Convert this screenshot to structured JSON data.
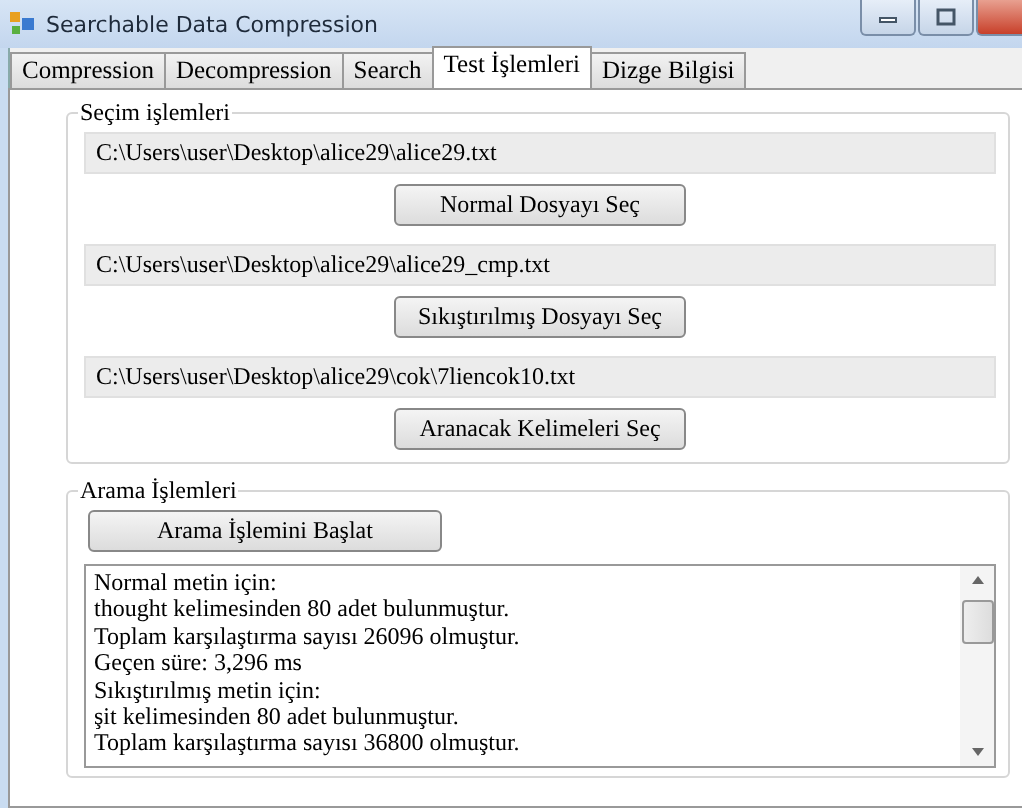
{
  "window": {
    "title": "Searchable Data Compression"
  },
  "tabs": [
    {
      "label": "Compression",
      "selected": false
    },
    {
      "label": "Decompression",
      "selected": false
    },
    {
      "label": "Search",
      "selected": false
    },
    {
      "label": "Test İşlemleri",
      "selected": true
    },
    {
      "label": "Dizge Bilgisi",
      "selected": false
    }
  ],
  "selection_group": {
    "title": "Seçim işlemleri",
    "rows": [
      {
        "path": "C:\\Users\\user\\Desktop\\alice29\\alice29.txt",
        "button": "Normal Dosyayı Seç"
      },
      {
        "path": "C:\\Users\\user\\Desktop\\alice29\\alice29_cmp.txt",
        "button": "Sıkıştırılmış Dosyayı Seç"
      },
      {
        "path": "C:\\Users\\user\\Desktop\\alice29\\cok\\7liencok10.txt",
        "button": "Aranacak Kelimeleri Seç"
      }
    ]
  },
  "search_group": {
    "title": "Arama İşlemleri",
    "button": "Arama İşlemini Başlat",
    "output": [
      "Normal metin için:",
      "thought kelimesinden 80 adet bulunmuştur.",
      "Toplam karşılaştırma sayısı 26096 olmuştur.",
      "Geçen süre: 3,296 ms",
      "Sıkıştırılmış metin için:",
      "şit kelimesinden 80 adet bulunmuştur.",
      "Toplam karşılaştırma sayısı 36800 olmuştur."
    ]
  }
}
